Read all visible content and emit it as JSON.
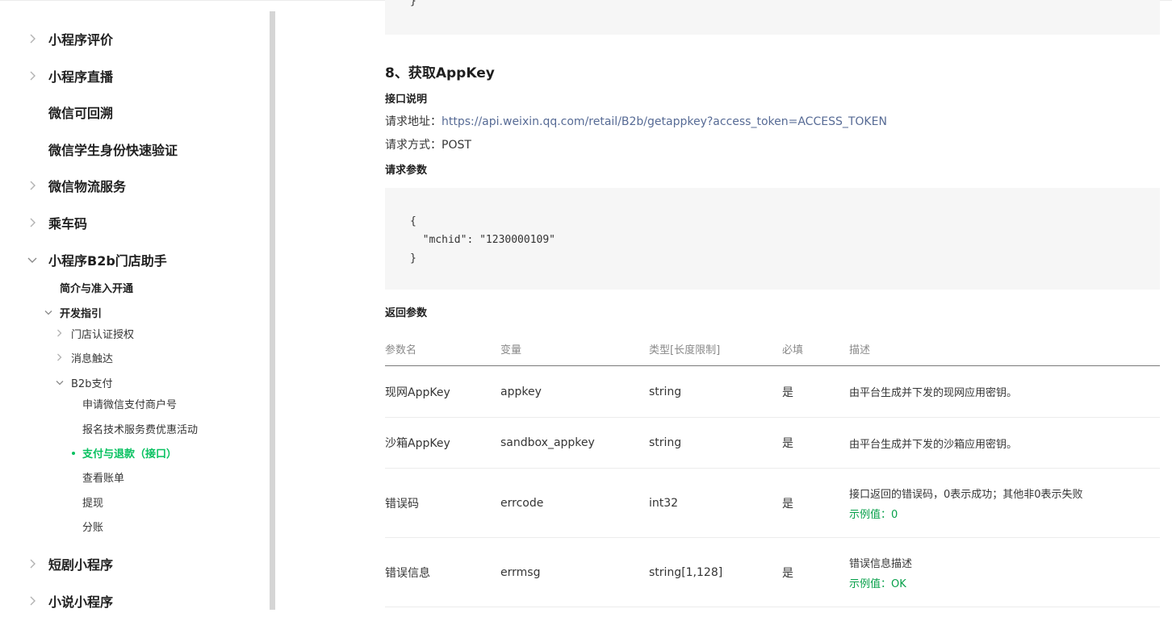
{
  "sidebar": {
    "items_top": [
      {
        "label": "小程序评价",
        "expandable": true
      },
      {
        "label": "小程序直播",
        "expandable": true
      },
      {
        "label": "微信可回溯",
        "expandable": false
      },
      {
        "label": "微信学生身份快速验证",
        "expandable": false
      },
      {
        "label": "微信物流服务",
        "expandable": true
      },
      {
        "label": "乘车码",
        "expandable": true
      },
      {
        "label": "小程序B2b门店助手",
        "expandable": true,
        "expanded": true
      }
    ],
    "b2b": {
      "intro": "简介与准入开通",
      "dev_guide": "开发指引",
      "store_auth": "门店认证授权",
      "msg_reach": "消息触达",
      "b2b_pay": "B2b支付",
      "pay_children": [
        "申请微信支付商户号",
        "报名技术服务费优惠活动",
        "支付与退款（接口）",
        "查看账单",
        "提现",
        "分账"
      ],
      "active_index": 2
    },
    "items_bottom": [
      {
        "label": "短剧小程序",
        "expandable": true
      },
      {
        "label": "小说小程序",
        "expandable": true
      }
    ]
  },
  "main": {
    "code_top_tail": "}",
    "section_title": "8、获取AppKey",
    "api_desc_label": "接口说明",
    "request_url_label": "请求地址：",
    "request_url": "https://api.weixin.qq.com/retail/B2b/getappkey?access_token=ACCESS_TOKEN",
    "request_method_label": "请求方式：",
    "request_method": "POST",
    "request_params_label": "请求参数",
    "request_code": "{\n  \"mchid\": \"1230000109\"\n}",
    "return_params_label": "返回参数",
    "table": {
      "headers": [
        "参数名",
        "变量",
        "类型[长度限制]",
        "必填",
        "描述"
      ],
      "rows": [
        {
          "name": "现网AppKey",
          "var": "appkey",
          "type": "string",
          "required": "是",
          "desc": "由平台生成并下发的现网应用密钥。",
          "example": ""
        },
        {
          "name": "沙箱AppKey",
          "var": "sandbox_appkey",
          "type": "string",
          "required": "是",
          "desc": "由平台生成并下发的沙箱应用密钥。",
          "example": ""
        },
        {
          "name": "错误码",
          "var": "errcode",
          "type": "int32",
          "required": "是",
          "desc": "接口返回的错误码，0表示成功；其他非0表示失败",
          "example": "示例值：0"
        },
        {
          "name": "错误信息",
          "var": "errmsg",
          "type": "string[1,128]",
          "required": "是",
          "desc": "错误信息描述",
          "example": "示例值：OK"
        }
      ]
    }
  },
  "colors": {
    "accent": "#07c160",
    "link": "#576b95",
    "example": "#07a04a"
  }
}
